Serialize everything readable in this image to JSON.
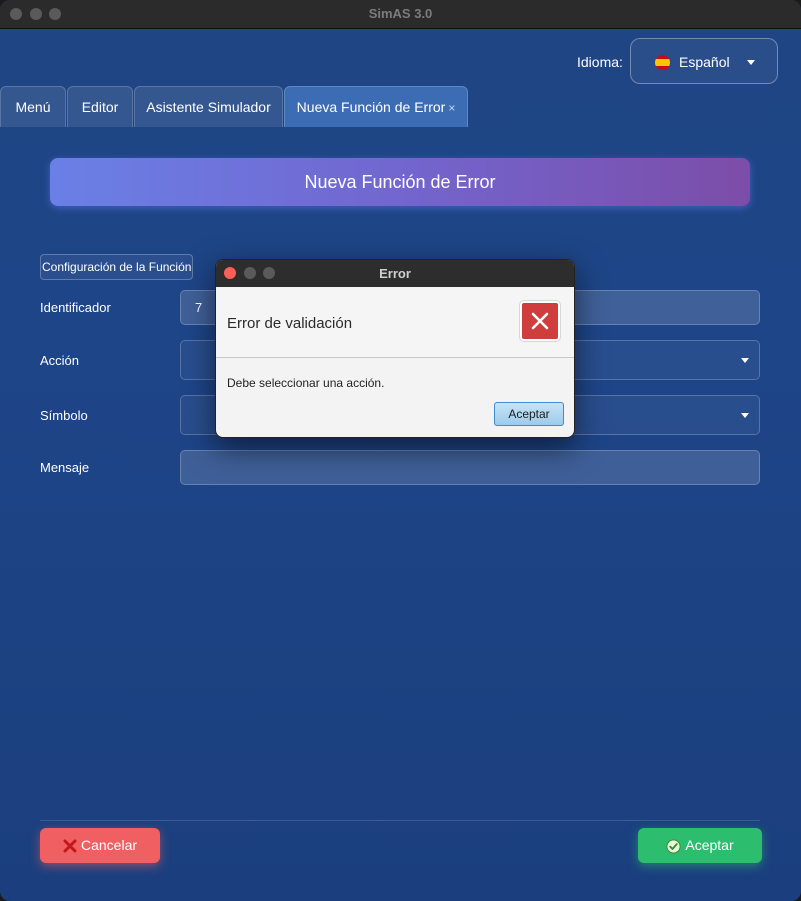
{
  "window": {
    "title": "SimAS 3.0"
  },
  "language": {
    "label": "Idioma:",
    "selected": "Español",
    "flag_icon": "spain-flag-icon"
  },
  "tabs": [
    {
      "label": "Menú"
    },
    {
      "label": "Editor"
    },
    {
      "label": "Asistente Simulador"
    },
    {
      "label": "Nueva Función de Error",
      "close": "×",
      "active": true
    }
  ],
  "banner": {
    "title": "Nueva Función de Error"
  },
  "section": {
    "label": "Configuración de la Función"
  },
  "form": {
    "identificador": {
      "label": "Identificador",
      "value": "7"
    },
    "accion": {
      "label": "Acción",
      "value": ""
    },
    "simbolo": {
      "label": "Símbolo",
      "value": ""
    },
    "mensaje": {
      "label": "Mensaje",
      "value": ""
    }
  },
  "buttons": {
    "cancel": "Cancelar",
    "accept": "Aceptar"
  },
  "dialog": {
    "title": "Error",
    "header": "Error de validación",
    "message": "Debe seleccionar una acción.",
    "ok": "Aceptar"
  },
  "colors": {
    "accent": "#3c6db4",
    "cancel": "#f05f62",
    "accept": "#2dbd6e",
    "error": "#cf3d3d"
  }
}
